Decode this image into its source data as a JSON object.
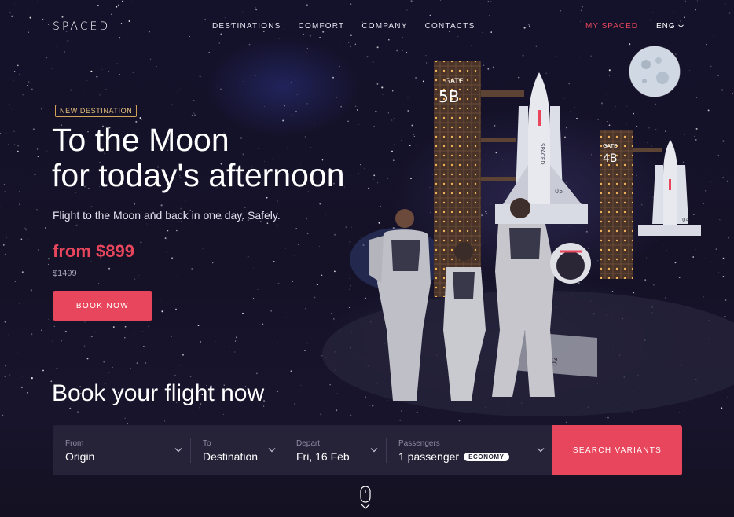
{
  "header": {
    "logo": "SPACED",
    "nav": [
      "DESTINATIONS",
      "COMFORT",
      "COMPANY",
      "CONTACTS"
    ],
    "account_link": "MY SPACED",
    "language": "ENG"
  },
  "hero": {
    "badge": "NEW DESTINATION",
    "title_line1": "To the Moon",
    "title_line2": "for today's afternoon",
    "subtitle": "Flight to the Moon and back in one day. Safely.",
    "price": "from $899",
    "old_price": "$1499",
    "cta": "BOOK NOW"
  },
  "scene": {
    "gate_left": [
      "GATE",
      "5B"
    ],
    "gate_right": [
      "GATE",
      "4B"
    ],
    "rocket_brand": "SPACED",
    "rocket_left_number": "05",
    "rocket_right_number": "04",
    "ramp_number": "02"
  },
  "booking": {
    "title": "Book your flight now",
    "fields": [
      {
        "label": "From",
        "value": "Origin"
      },
      {
        "label": "To",
        "value": "Destination"
      },
      {
        "label": "Depart",
        "value": "Fri, 16 Feb"
      },
      {
        "label": "Passengers",
        "value": "1 passenger",
        "badge": "ECONOMY"
      }
    ],
    "search_button": "SEARCH VARIANTS"
  },
  "colors": {
    "accent": "#e8465c",
    "background": "#141126",
    "search_bar": "#262338",
    "badge_border": "#d3a457"
  },
  "icons": [
    "chevron-down-icon",
    "mouse-scroll-icon",
    "moon-icon"
  ]
}
